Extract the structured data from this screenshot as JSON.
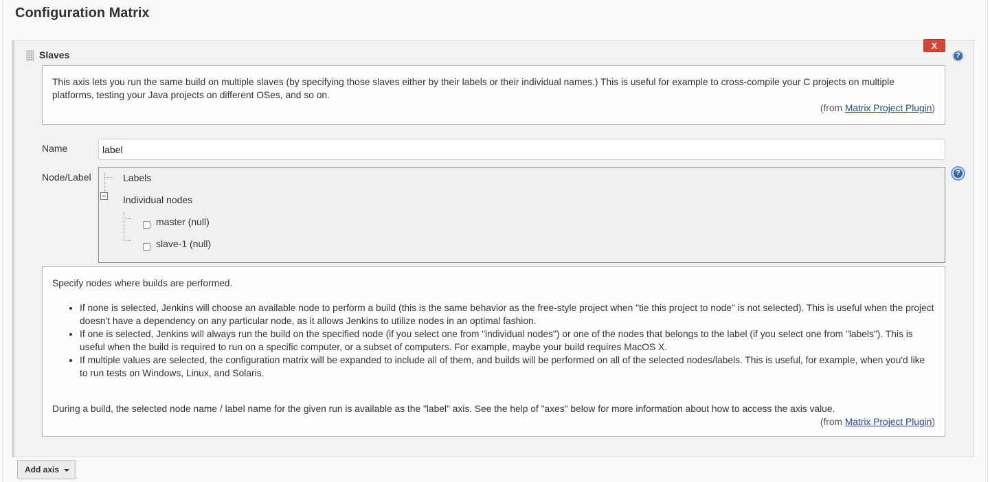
{
  "section": {
    "title": "Configuration Matrix"
  },
  "axis": {
    "title": "Slaves",
    "delete_label": "X",
    "help_icon_glyph": "?",
    "description": "This axis lets you run the same build on multiple slaves (by specifying those slaves either by their labels or their individual names.) This is useful for example to cross-compile your C projects on multiple platforms, testing your Java projects on different OSes, and so on.",
    "from_prefix": "(from ",
    "from_link": "Matrix Project Plugin",
    "from_suffix": ")"
  },
  "name_field": {
    "label": "Name",
    "value": "label"
  },
  "node_field": {
    "label": "Node/Label",
    "tree": {
      "labels_item": "Labels",
      "individual_item": "Individual nodes",
      "nodes": [
        {
          "label": "master (null)",
          "checked": false
        },
        {
          "label": "slave-1 (null)",
          "checked": false
        }
      ]
    }
  },
  "node_help": {
    "intro": "Specify nodes where builds are performed.",
    "bullets": [
      "If none is selected, Jenkins will choose an available node to perform a build (this is the same behavior as the free-style project when \"tie this project to node\" is not selected). This is useful when the project doesn't have a dependency on any particular node, as it allows Jenkins to utilize nodes in an optimal fashion.",
      "If one is selected, Jenkins will always run the build on the specified node (if you select one from \"individual nodes\") or one of the nodes that belongs to the label (if you select one from \"labels\"). This is useful when the build is required to run on a specific computer, or a subset of computers. For example, maybe your build requires MacOS X.",
      "If multiple values are selected, the configuration matrix will be expanded to include all of them, and builds will be performed on all of the selected nodes/labels. This is useful, for example, when you'd like to run tests on Windows, Linux, and Solaris."
    ],
    "footer": "During a build, the selected node name / label name for the given run is available as the \"label\" axis. See the help of \"axes\" below for more information about how to access the axis value.",
    "from_prefix": "(from ",
    "from_link": "Matrix Project Plugin",
    "from_suffix": ")"
  },
  "add_axis": {
    "label": "Add axis"
  },
  "icons": {
    "help": "help-icon",
    "delete": "close-icon",
    "drag": "drag-handle-icon",
    "collapse": "collapse-toggle-icon",
    "dropdown": "chevron-down-icon"
  },
  "colors": {
    "delete_button": "#d24939",
    "help_icon": "#3f6da9",
    "link": "#204a87"
  }
}
